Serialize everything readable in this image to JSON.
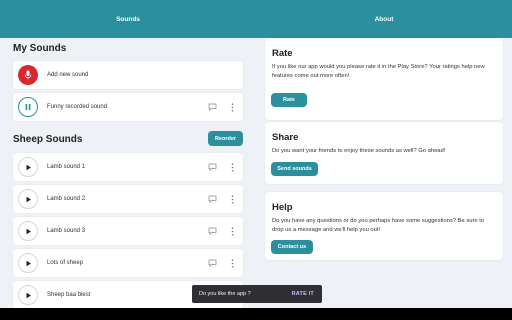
{
  "tabs": [
    {
      "label": "Sounds"
    },
    {
      "label": "About"
    }
  ],
  "my_sounds": {
    "title": "My Sounds",
    "items": [
      {
        "label": "Add new sound",
        "icon": "mic-icon"
      },
      {
        "label": "Funny recorded sound",
        "icon": "pause-icon"
      }
    ]
  },
  "sheep_sounds": {
    "title": "Sheep Sounds",
    "reorder_label": "Reorder",
    "items": [
      {
        "label": "Lamb sound 1"
      },
      {
        "label": "Lamb sound 2"
      },
      {
        "label": "Lamb sound 3"
      },
      {
        "label": "Lots of sheep"
      },
      {
        "label": "Sheep baa blest"
      }
    ]
  },
  "about": {
    "rate": {
      "title": "Rate",
      "body": "If you like our app would you please rate it in the Play Store? Your ratings help new features come out more often!",
      "button": "Rate"
    },
    "share": {
      "title": "Share",
      "body": "Do you want your friends to enjoy these sounds as well? Go ahead!",
      "button": "Send sounds"
    },
    "help": {
      "title": "Help",
      "body": "Do you have any questions or do you perhaps have some suggestions? Be sure to drop us a message and we'll help you out!",
      "button": "Contact us"
    }
  },
  "snackbar": {
    "text": "Do you like the app ?",
    "action": "RATE IT"
  },
  "colors": {
    "accent": "#2b8f9d",
    "record": "#d8272e",
    "snackbar_action": "#c7b7ff"
  }
}
